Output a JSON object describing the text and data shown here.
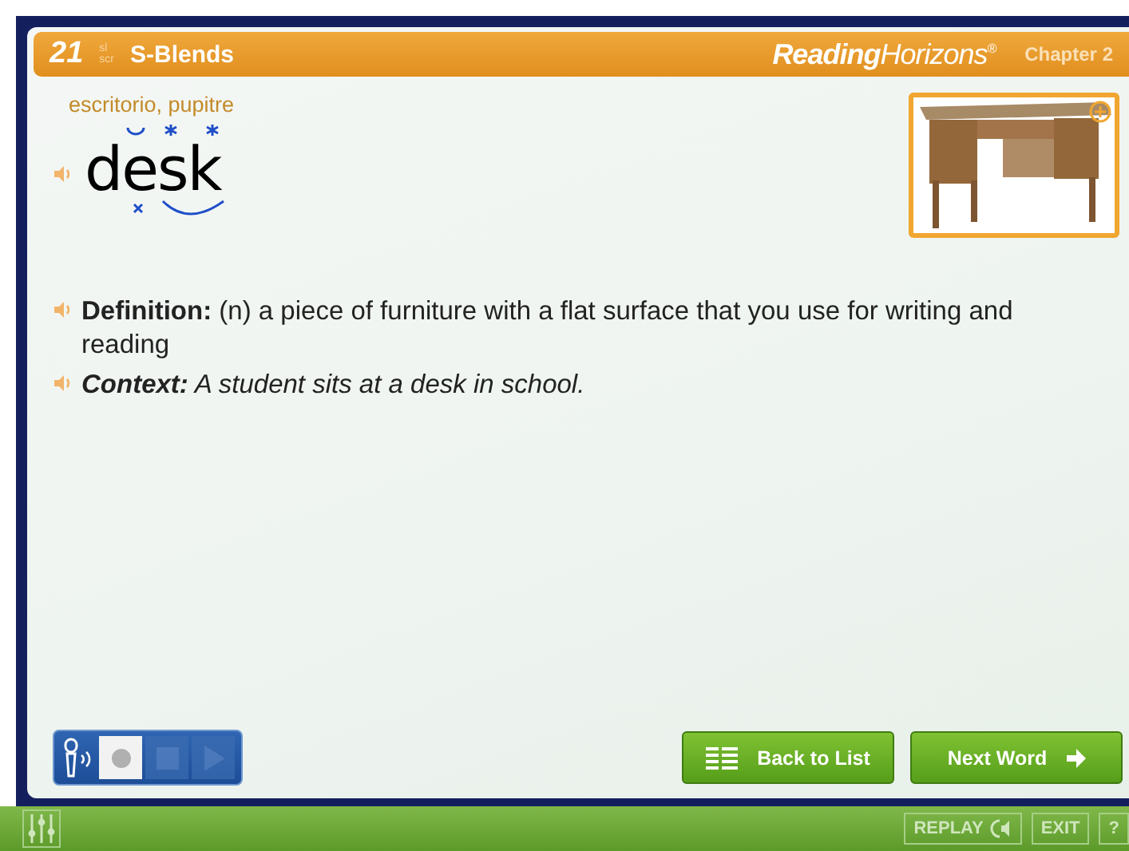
{
  "header": {
    "number": "21",
    "blend_marks": [
      "sl",
      "scr"
    ],
    "title": "S-Blends",
    "brand_bold": "Reading",
    "brand_light": "Horizons",
    "brand_mark": "®",
    "chapter": "Chapter 2"
  },
  "word": {
    "translation": "escritorio, pupitre",
    "text": "desk"
  },
  "entries": [
    {
      "label": "Definition:",
      "text": "(n) a piece of furniture with a flat surface that you use for writing and reading",
      "italic": false
    },
    {
      "label": "Context:",
      "text": "A student sits at a desk in school.",
      "italic": true
    }
  ],
  "recorder": [
    {
      "kind": "record",
      "selected": true,
      "disabled": false
    },
    {
      "kind": "stop",
      "selected": false,
      "disabled": true
    },
    {
      "kind": "play",
      "selected": false,
      "disabled": true
    }
  ],
  "buttons": [
    {
      "kind": "list",
      "label": "Back to List"
    },
    {
      "kind": "next",
      "label": "Next Word"
    }
  ],
  "footer": {
    "replay": "REPLAY",
    "exit": "EXIT",
    "help": "?"
  }
}
